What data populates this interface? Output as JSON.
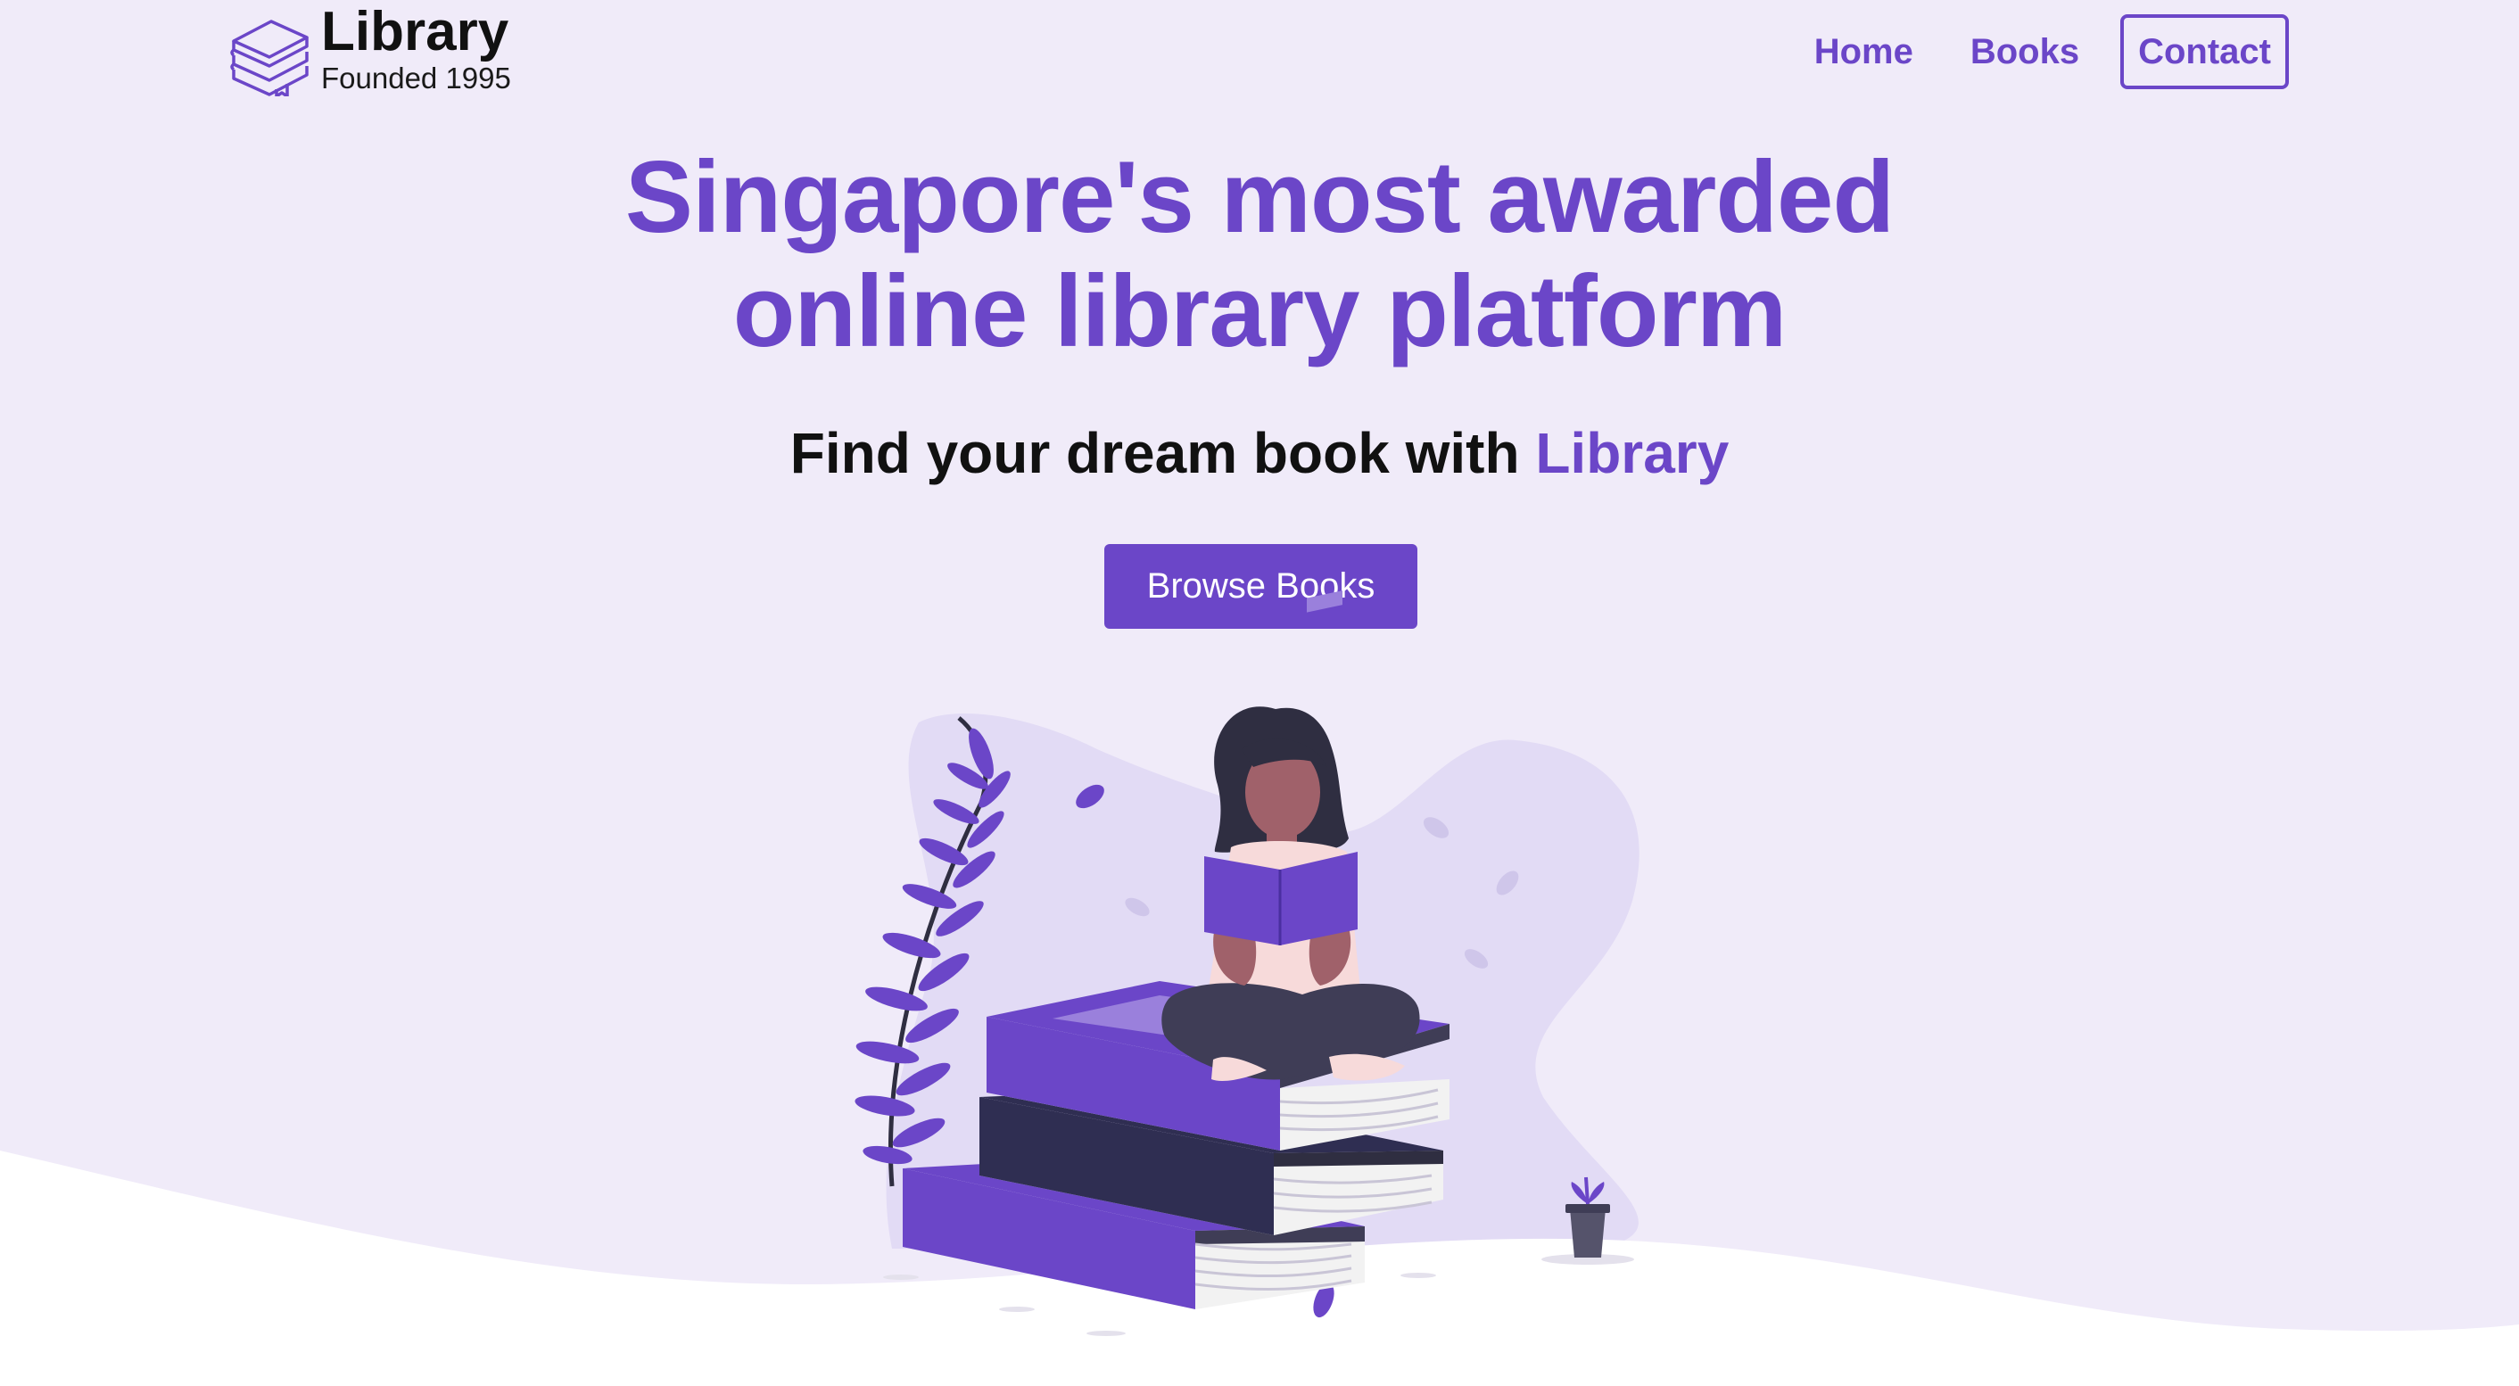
{
  "header": {
    "logo_title": "Library",
    "logo_subtitle": "Founded 1995",
    "logo_icon": "stacked-books-icon"
  },
  "nav": {
    "home": "Home",
    "books": "Books",
    "contact": "Contact"
  },
  "hero": {
    "title_line1": "Singapore's most awarded",
    "title_line2": "online library platform",
    "subtitle_prefix": "Find your dream book with",
    "subtitle_accent": "Library",
    "cta": "Browse Books"
  },
  "colors": {
    "accent": "#6b46c8",
    "background": "#f0ebf9",
    "blob": "#e2dbf5",
    "dark_book": "#2f2e41"
  }
}
